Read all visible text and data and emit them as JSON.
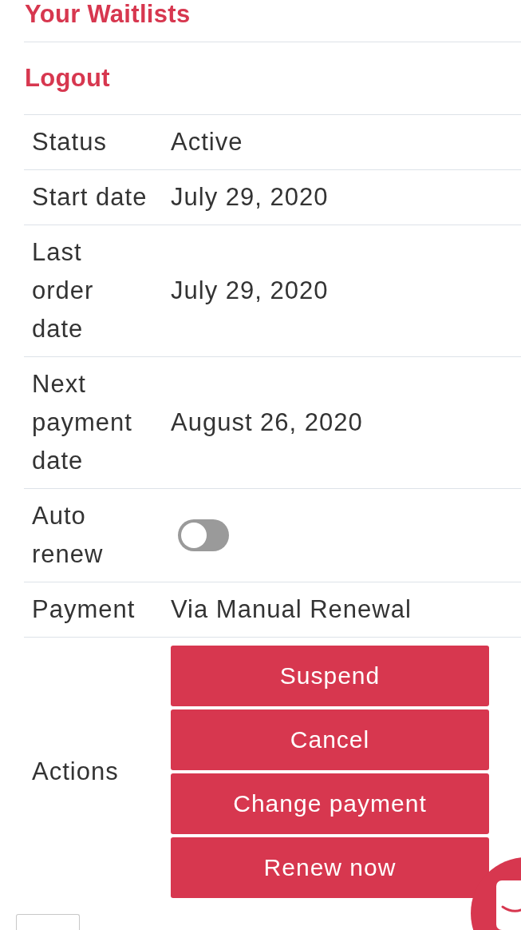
{
  "nav": [
    "Your Waitlists",
    "Logout"
  ],
  "details": [
    {
      "kind": "text",
      "label": "Status",
      "value": "Active"
    },
    {
      "kind": "text",
      "label": "Start date",
      "value": "July 29, 2020"
    },
    {
      "kind": "text",
      "label": "Last order date",
      "value": "July 29, 2020"
    },
    {
      "kind": "text",
      "label": "Next payment date",
      "value": "August 26, 2020"
    },
    {
      "kind": "toggle",
      "label": "Auto renew",
      "on": false
    },
    {
      "kind": "text",
      "label": "Payment",
      "value": "Via Manual Renewal"
    },
    {
      "kind": "actions",
      "label": "Actions",
      "buttons": [
        "Suspend",
        "Cancel",
        "Change payment",
        "Renew now"
      ]
    }
  ]
}
